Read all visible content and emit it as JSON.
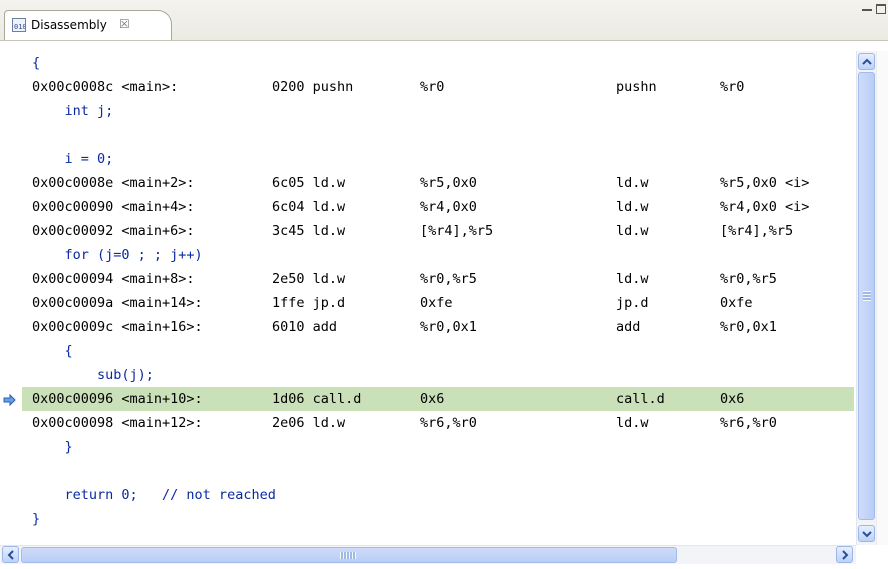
{
  "tab": {
    "title": "Disassembly",
    "close_glyph": "☒",
    "icon": "disassembly-view-icon"
  },
  "lines": [
    {
      "type": "src",
      "text": "{"
    },
    {
      "type": "asm",
      "cols": [
        "0x00c0008c <main>:",
        "0200 pushn",
        "%r0",
        "pushn",
        "%r0"
      ]
    },
    {
      "type": "src",
      "text": "    int j;"
    },
    {
      "type": "src",
      "text": ""
    },
    {
      "type": "src",
      "text": "    i = 0;"
    },
    {
      "type": "asm",
      "cols": [
        "0x00c0008e <main+2>:",
        "6c05 ld.w",
        "%r5,0x0",
        "ld.w",
        "%r5,0x0 <i>"
      ]
    },
    {
      "type": "asm",
      "cols": [
        "0x00c00090 <main+4>:",
        "6c04 ld.w",
        "%r4,0x0",
        "ld.w",
        "%r4,0x0 <i>"
      ]
    },
    {
      "type": "asm",
      "cols": [
        "0x00c00092 <main+6>:",
        "3c45 ld.w",
        "[%r4],%r5",
        "ld.w",
        "[%r4],%r5"
      ]
    },
    {
      "type": "src",
      "text": "    for (j=0 ; ; j++)"
    },
    {
      "type": "asm",
      "cols": [
        "0x00c00094 <main+8>:",
        "2e50 ld.w",
        "%r0,%r5",
        "ld.w",
        "%r0,%r5"
      ]
    },
    {
      "type": "asm",
      "cols": [
        "0x00c0009a <main+14>:",
        "1ffe jp.d",
        "0xfe",
        "jp.d",
        "0xfe"
      ]
    },
    {
      "type": "asm",
      "cols": [
        "0x00c0009c <main+16>:",
        "6010 add",
        "%r0,0x1",
        "add",
        "%r0,0x1"
      ]
    },
    {
      "type": "src",
      "text": "    {"
    },
    {
      "type": "src",
      "text": "        sub(j);"
    },
    {
      "type": "asm",
      "current": true,
      "cols": [
        "0x00c00096 <main+10>:",
        "1d06 call.d",
        "0x6",
        "call.d",
        "0x6"
      ]
    },
    {
      "type": "asm",
      "cols": [
        "0x00c00098 <main+12>:",
        "2e06 ld.w",
        "%r6,%r0",
        "ld.w",
        "%r6,%r0"
      ]
    },
    {
      "type": "src",
      "text": "    }"
    },
    {
      "type": "src",
      "text": ""
    },
    {
      "type": "src",
      "text": "    return 0;   // not reached"
    },
    {
      "type": "src",
      "text": "}"
    }
  ],
  "colors": {
    "source_text": "#0a2aa0",
    "current_line": "#c9e0b9",
    "scroll_accent": "#b9cdf6"
  }
}
